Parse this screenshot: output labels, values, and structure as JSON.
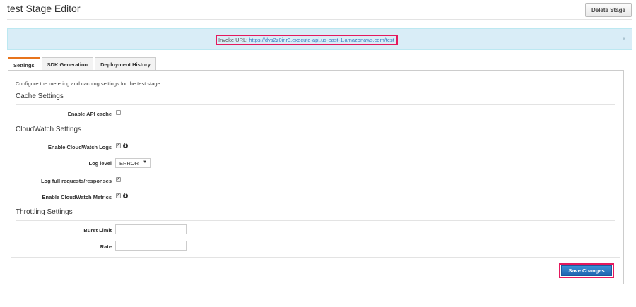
{
  "header": {
    "title": "test Stage Editor",
    "delete_label": "Delete Stage"
  },
  "banner": {
    "invoke_prefix": "Invoke URL:",
    "invoke_url": "https://dvs2z0inr3.execute-api.us-east-1.amazonaws.com/test",
    "close_glyph": "×"
  },
  "tabs": [
    {
      "label": "Settings",
      "active": true
    },
    {
      "label": "SDK Generation",
      "active": false
    },
    {
      "label": "Deployment History",
      "active": false
    }
  ],
  "settings": {
    "intro": "Configure the metering and caching settings for the test stage.",
    "cache": {
      "title": "Cache Settings",
      "enable_api_cache_label": "Enable API cache",
      "enable_api_cache": false
    },
    "cloudwatch": {
      "title": "CloudWatch Settings",
      "enable_logs_label": "Enable CloudWatch Logs",
      "enable_logs": true,
      "log_level_label": "Log level",
      "log_level_value": "ERROR",
      "log_full_label": "Log full requests/responses",
      "log_full": true,
      "enable_metrics_label": "Enable CloudWatch Metrics",
      "enable_metrics": true
    },
    "throttling": {
      "title": "Throttling Settings",
      "burst_label": "Burst Limit",
      "burst_value": "",
      "rate_label": "Rate",
      "rate_value": ""
    },
    "save_label": "Save Changes"
  },
  "glyphs": {
    "check": "✔",
    "info": "i",
    "caret": "▼"
  },
  "colors": {
    "banner_bg": "#d9edf7",
    "highlight": "#e5195d",
    "primary": "#1f64b0",
    "active_tab": "#e7741c"
  }
}
